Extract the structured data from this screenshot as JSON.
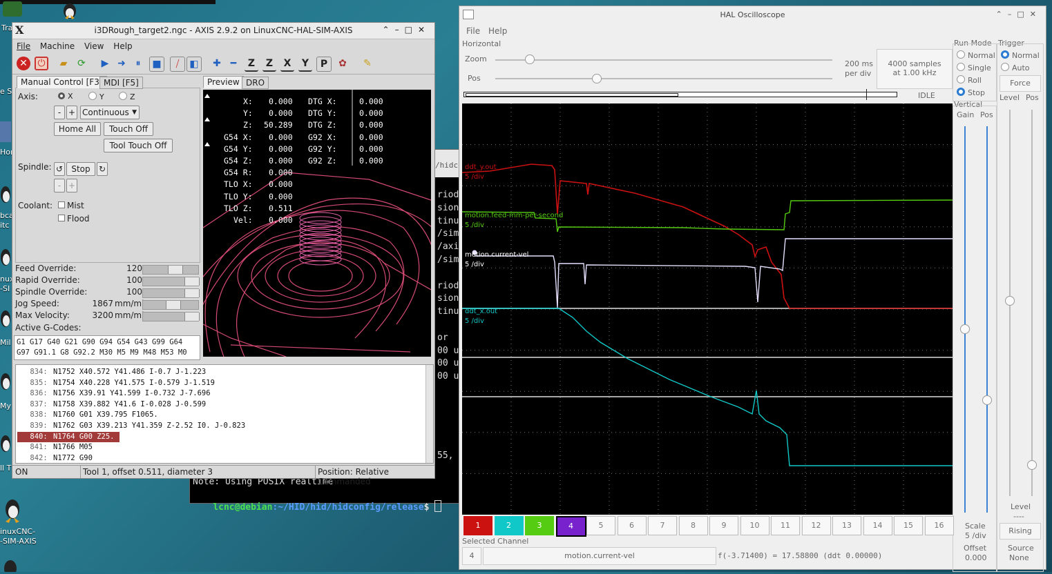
{
  "desktop": {
    "labels": [
      "Tra",
      "e S",
      "Hor",
      "bca",
      "itc",
      "nuxC",
      "-SI",
      "Mil",
      "My",
      "ll T",
      "inuxCNC-",
      "-SIM-AXIS"
    ]
  },
  "axis": {
    "title": "i3DRough_target2.ngc - AXIS 2.9.2 on LinuxCNC-HAL-SIM-AXIS",
    "menu": [
      "File",
      "Machine",
      "View",
      "Help"
    ],
    "tabs_left": [
      "Manual Control [F3]",
      "MDI [F5]"
    ],
    "tabs_right": [
      "Preview",
      "DRO"
    ],
    "axis_label": "Axis:",
    "axes": [
      "X",
      "Y",
      "Z"
    ],
    "jog_minus": "-",
    "jog_plus": "+",
    "jog_mode": "Continuous",
    "home_all": "Home All",
    "touch_off": "Touch Off",
    "tool_touch_off": "Tool Touch Off",
    "spindle_label": "Spindle:",
    "spindle_stop": "Stop",
    "coolant_label": "Coolant:",
    "mist": "Mist",
    "flood": "Flood",
    "overrides": [
      {
        "label": "Feed Override:",
        "value": "120",
        "unit": "%",
        "level": 0.6
      },
      {
        "label": "Rapid Override:",
        "value": "100",
        "unit": "%",
        "level": 1.0
      },
      {
        "label": "Spindle Override:",
        "value": "100",
        "unit": "%",
        "level": 1.0
      },
      {
        "label": "Jog Speed:",
        "value": "1867",
        "unit": "mm/min",
        "level": 0.55
      },
      {
        "label": "Max Velocity:",
        "value": "3200",
        "unit": "mm/min",
        "level": 1.0
      }
    ],
    "active_gcodes_label": "Active G-Codes:",
    "active_gcodes": [
      "G1 G17 G40 G21 G90 G94 G54 G43 G99 G64",
      "G97 G91.1 G8 G92.2 M30 M5 M9 M48 M53 M0"
    ],
    "dro": [
      {
        "a": "X:",
        "v": "0.000",
        "b": "DTG X:",
        "w": "0.000"
      },
      {
        "a": "Y:",
        "v": "0.000",
        "b": "DTG Y:",
        "w": "0.000"
      },
      {
        "a": "Z:",
        "v": "50.289",
        "b": "DTG Z:",
        "w": "0.000"
      },
      {
        "a": "G54 X:",
        "v": "0.000",
        "b": "G92 X:",
        "w": "0.000"
      },
      {
        "a": "G54 Y:",
        "v": "0.000",
        "b": "G92 Y:",
        "w": "0.000"
      },
      {
        "a": "G54 Z:",
        "v": "0.000",
        "b": "G92 Z:",
        "w": "0.000"
      },
      {
        "a": "G54 R:",
        "v": "0.000",
        "b": "",
        "w": ""
      },
      {
        "a": "TLO X:",
        "v": "0.000",
        "b": "",
        "w": ""
      },
      {
        "a": "TLO Y:",
        "v": "0.000",
        "b": "",
        "w": ""
      },
      {
        "a": "TLO Z:",
        "v": "0.511",
        "b": "",
        "w": ""
      },
      {
        "a": "Vel:",
        "v": "0.000",
        "b": "",
        "w": ""
      }
    ],
    "gcode_lines": [
      {
        "n": "834:",
        "t": "N1752 X40.572 Y41.486 I-0.7 J-1.223"
      },
      {
        "n": "835:",
        "t": "N1754 X40.228 Y41.575 I-0.579 J-1.519"
      },
      {
        "n": "836:",
        "t": "N1756 X39.91 Y41.599 I-0.732 J-7.696"
      },
      {
        "n": "837:",
        "t": "N1758 X39.882 Y41.6 I-0.028 J-0.599"
      },
      {
        "n": "838:",
        "t": "N1760 G01 X39.795 F1065."
      },
      {
        "n": "839:",
        "t": "N1762 G03 X39.213 Y41.359 Z-2.52 I0. J-0.823"
      },
      {
        "n": "840:",
        "t": "N1764 G00 Z25."
      },
      {
        "n": "841:",
        "t": "N1766 M05"
      },
      {
        "n": "842:",
        "t": "N1772 G90"
      }
    ],
    "highlight_line": 6,
    "status": {
      "state": "ON",
      "tool": "Tool 1, offset 0.511, diameter 3",
      "position": "Position: Relative Commanded"
    }
  },
  "terminal": {
    "tab_label": "/hidco",
    "lines": [
      "riod",
      "sion",
      "tinu",
      "/sim",
      "/axi",
      "/sim",
      "",
      "riod",
      "sion",
      "tinu",
      "",
      "or",
      "00 u",
      "00 u",
      "00 u"
    ],
    "line55": "55,",
    "note": "Note: Using POSIX realtime",
    "prompt_user": "lcnc@debian",
    "prompt_path": ":~/HID/hid/hidconfig/release",
    "prompt_end": "$ "
  },
  "scope": {
    "title": "HAL Oscilloscope",
    "menu": [
      "File",
      "Help"
    ],
    "horizontal_label": "Horizontal",
    "zoom_label": "Zoom",
    "pos_label": "Pos",
    "zoom_level": 0.1,
    "pos_level": 0.3,
    "rate": "200 ms",
    "rate2": "per div",
    "samples": "4000 samples",
    "samples2": "at 1.00 kHz",
    "state": "IDLE",
    "run_mode_label": "Run Mode",
    "run_modes": [
      {
        "label": "Normal",
        "on": false
      },
      {
        "label": "Single",
        "on": false
      },
      {
        "label": "Roll",
        "on": false
      },
      {
        "label": "Stop",
        "on": true
      }
    ],
    "trigger_label": "Trigger",
    "trigger_modes": [
      {
        "label": "Normal",
        "on": true
      },
      {
        "label": "Auto",
        "on": false
      }
    ],
    "force": "Force",
    "vertical_label": "Vertical",
    "gain_label": "Gain",
    "vpos_label": "Pos",
    "level_label": "Level",
    "tpos_label": "Pos",
    "scale_label": "Scale",
    "scale_value": "5 /div",
    "offset_label": "Offset",
    "offset_value": "0.000",
    "level_box_label": "Level",
    "level_box_value": "----",
    "rising": "Rising",
    "source_label": "Source",
    "source_value": "None",
    "channels": [
      "1",
      "2",
      "3",
      "4",
      "5",
      "6",
      "7",
      "8",
      "9",
      "10",
      "11",
      "12",
      "13",
      "14",
      "15",
      "16"
    ],
    "channel_colors": [
      "#cc1111",
      "#11c8c8",
      "#55cc11",
      "#7722cc"
    ],
    "selected_channel_label": "Selected Channel",
    "selected_channel": "4",
    "selected_name": "motion.current-vel",
    "readout": "f(-3.71400) =  17.58800 (ddt  0.00000)",
    "traces": [
      {
        "name": "ddt_y.out",
        "scale": "5 /div",
        "color": "#cc1111"
      },
      {
        "name": "motion.feed-mm-per-second",
        "scale": "5 /div",
        "color": "#55cc11"
      },
      {
        "name": "motion.current-vel",
        "scale": "5 /div",
        "color": "#e0d0ff"
      },
      {
        "name": "ddt_x.out",
        "scale": "5 /div",
        "color": "#11c8c8"
      }
    ]
  }
}
